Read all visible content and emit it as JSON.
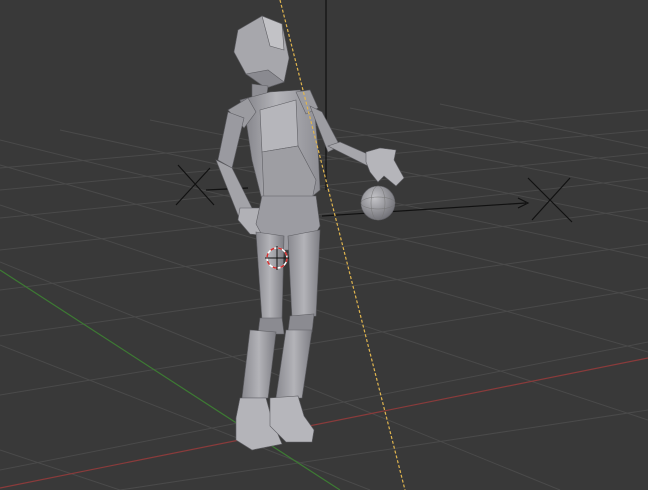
{
  "viewport": {
    "mode": "3d-viewport",
    "shading": "solid",
    "background_color": "#393939",
    "grid_color": "#4b4b4b",
    "x_axis_color": "#8a3b3b",
    "y_axis_color": "#3d7a33",
    "mesh_color": "#a9a9ad",
    "mesh_shadow_color": "#6f6f74",
    "light_line_color": "#e0b54f",
    "cursor_color": "#d43030"
  },
  "scene_objects": [
    {
      "name": "mannequin-mesh",
      "type": "mesh"
    },
    {
      "name": "sphere-mesh",
      "type": "mesh"
    },
    {
      "name": "armature-empty",
      "type": "empty"
    },
    {
      "name": "target-empty",
      "type": "empty"
    },
    {
      "name": "sun-lamp",
      "type": "lamp"
    },
    {
      "name": "3d-cursor",
      "type": "cursor"
    }
  ]
}
